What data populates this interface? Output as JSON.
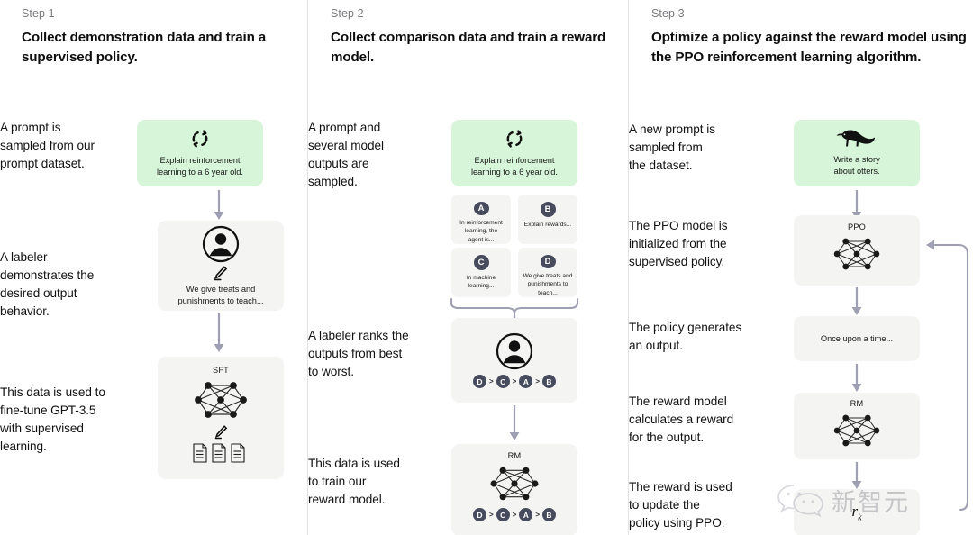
{
  "steps": [
    {
      "label": "Step 1",
      "title": "Collect demonstration data\nand train a supervised policy.",
      "descriptions": [
        "A prompt is\nsampled from our\nprompt dataset.",
        "A labeler\ndemonstrates the\ndesired output\nbehavior.",
        "This data is used to\nfine-tune GPT-3.5\nwith supervised\nlearning."
      ],
      "cards": [
        {
          "icon": "refresh-cycle-icon",
          "text": "Explain reinforcement\nlearning to a 6 year old.",
          "style": "green"
        },
        {
          "icon": "labeler-person-icon",
          "text": "We give treats and\npunishments to teach...",
          "style": "grey"
        },
        {
          "caption": "SFT",
          "icon": "neural-network-icon",
          "text": "",
          "style": "grey"
        }
      ]
    },
    {
      "label": "Step 2",
      "title": "Collect comparison data and\ntrain a reward model.",
      "descriptions": [
        "A prompt and\nseveral model\noutputs are\nsampled.",
        "A labeler ranks the\noutputs from best\nto worst.",
        "This data is used\nto train our\nreward model."
      ],
      "cards": [
        {
          "icon": "refresh-cycle-icon",
          "text": "Explain reinforcement\nlearning to a 6 year old.",
          "style": "green"
        },
        {
          "icon": "labeler-person-icon",
          "text": "",
          "style": "grey"
        },
        {
          "caption": "RM",
          "icon": "neural-network-icon",
          "text": "",
          "style": "grey"
        }
      ],
      "options": [
        {
          "badge": "A",
          "text": "In reinforcement\nlearning, the\nagent is..."
        },
        {
          "badge": "B",
          "text": "Explain rewards..."
        },
        {
          "badge": "C",
          "text": "In machine\nlearning..."
        },
        {
          "badge": "D",
          "text": "We give treats and\npunishments to\nteach..."
        }
      ],
      "ranking": [
        "D",
        "C",
        "A",
        "B"
      ],
      "ranking_separator": ">"
    },
    {
      "label": "Step 3",
      "title": "Optimize a policy against the\nreward model using the PPO\nreinforcement learning algorithm.",
      "descriptions": [
        "A new prompt is\nsampled from\nthe dataset.",
        "The PPO model is\ninitialized from the\nsupervised policy.",
        "The policy generates\nan output.",
        "The reward model\ncalculates a reward\nfor the output.",
        "The reward is used\nto update the\npolicy using PPO."
      ],
      "cards": [
        {
          "icon": "otter-icon",
          "text": "Write a story\nabout otters.",
          "style": "green"
        },
        {
          "caption": "PPO",
          "icon": "neural-network-icon",
          "text": "",
          "style": "grey"
        },
        {
          "icon": "",
          "text": "Once upon a time...",
          "style": "grey"
        },
        {
          "caption": "RM",
          "icon": "neural-network-icon",
          "text": "",
          "style": "grey"
        },
        {
          "icon": "reward-symbol",
          "text": "",
          "style": "grey",
          "formula": "r",
          "subscript": "k"
        }
      ]
    }
  ],
  "watermark": {
    "icon": "wechat-icon",
    "text": "新智元"
  },
  "colors": {
    "green_card": "#d7f5d9",
    "grey_card": "#f4f4f2",
    "badge": "#474b5e",
    "arrow": "#9f9fb3",
    "divider": "#e3e3e3",
    "step_label": "#7b7b7f"
  }
}
